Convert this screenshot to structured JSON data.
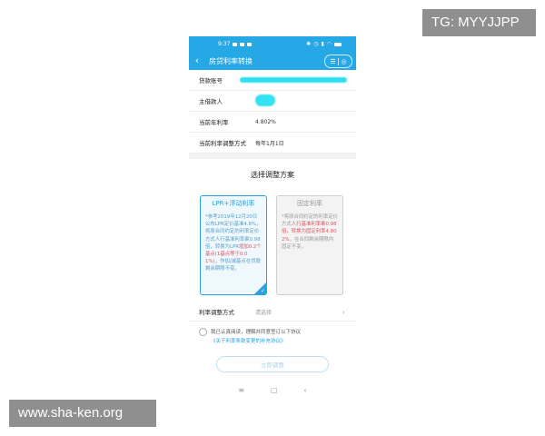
{
  "watermarks": {
    "tg": "TG: MYYJJPP",
    "site": "www.sha-ken.org"
  },
  "status_bar": {
    "time": "9:37"
  },
  "header": {
    "back_icon": "back-chevron-icon",
    "title": "房贷利率转换"
  },
  "info": {
    "account_label": "贷款账号",
    "borrower_label": "主借款人",
    "rate_label": "当前年利率",
    "rate_value": "4.802%",
    "adjust_label": "当前利率调整方式",
    "adjust_value": "每年1月1日"
  },
  "plan": {
    "title": "选择调整方案",
    "lpr": {
      "title": "LPR+浮动利率",
      "body_1": "*参考2019年12月20日公布LPR定价基准4.8%，将原合同约定的利率定价方式人行基准利率乘0.98倍，转换为LPR",
      "body_red": "增加0.2个基点(1基点等于0.01%)",
      "body_2": "，作加/减基点在贷款剩余期限不变。"
    },
    "fixed": {
      "title": "固定利率",
      "body_1": "*将原合同约定的利率定价方式",
      "body_red": "人行基准利率乘0.98倍，转换为固定利率4.802%",
      "body_2": "，在合同剩余期限内固定不变。"
    }
  },
  "method": {
    "label": "利率调整方式",
    "placeholder": "请选择"
  },
  "agreement": {
    "text": "我已认真阅读，理解并同意签订以下协议",
    "link": "《关于利率条款变更的补充协议》"
  },
  "confirm_label": "立即调整",
  "sysnav": {
    "menu": "≡",
    "home": "▢",
    "back": "‹"
  }
}
